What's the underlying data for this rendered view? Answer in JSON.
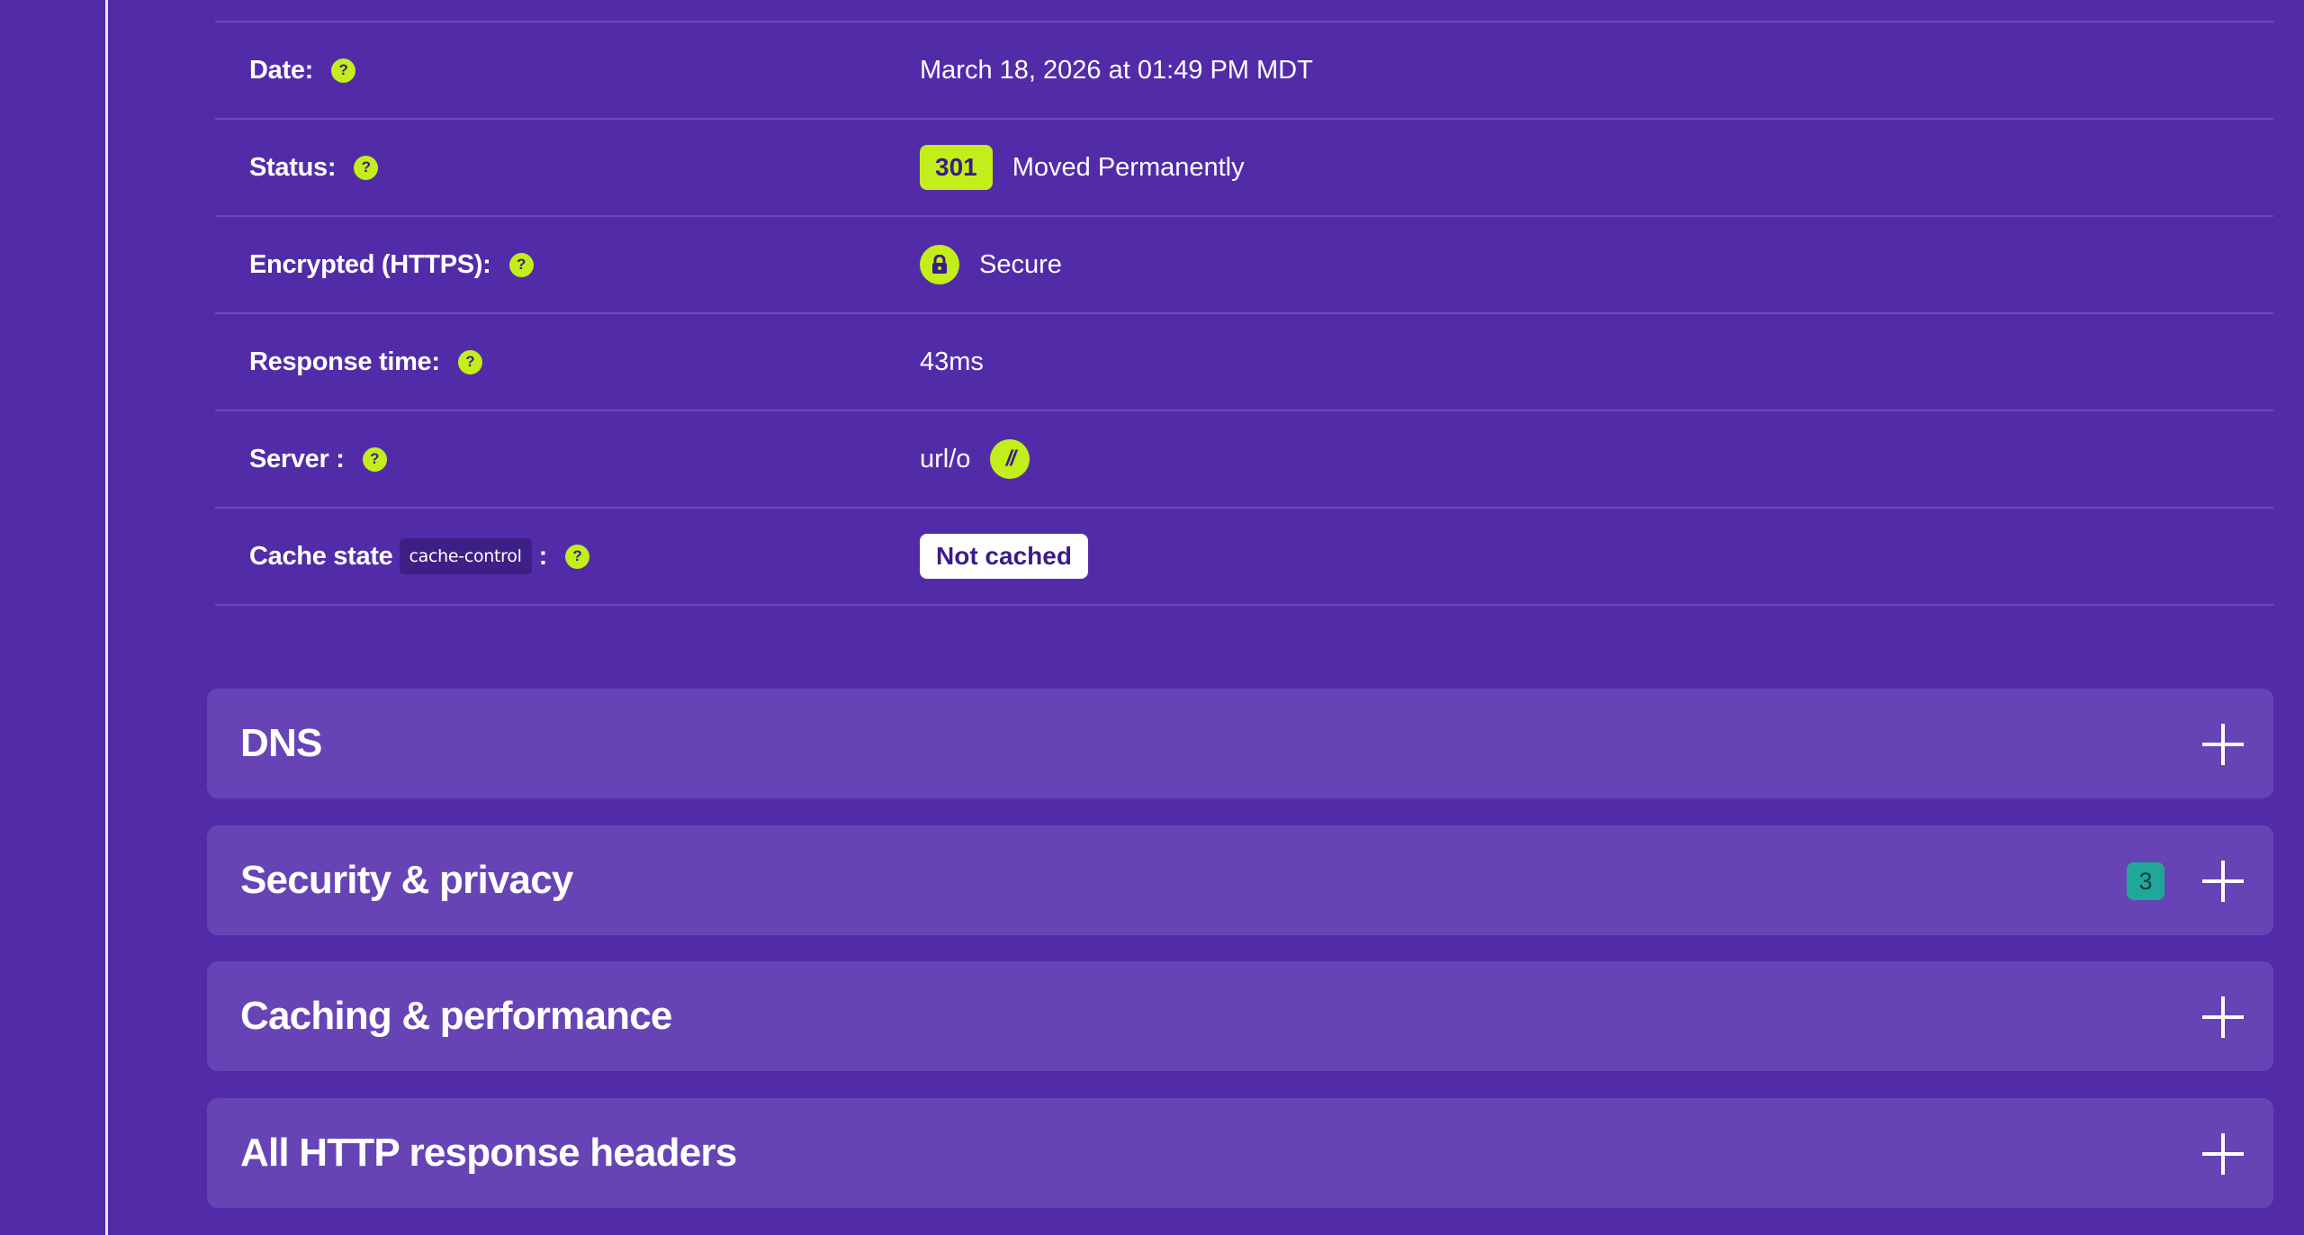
{
  "details": {
    "date": {
      "label": "Date:",
      "value": "March 18, 2026 at 01:49 PM MDT"
    },
    "status": {
      "label": "Status:",
      "code": "301",
      "text": "Moved Permanently"
    },
    "encrypted": {
      "label": "Encrypted (HTTPS):",
      "value": "Secure"
    },
    "response_time": {
      "label": "Response time:",
      "value": "43ms"
    },
    "server": {
      "label": "Server :",
      "value": "url/o",
      "logo_text": "//"
    },
    "cache_state": {
      "label": "Cache state",
      "chip": "cache-control",
      "colon": ":",
      "value": "Not cached"
    },
    "help_glyph": "?"
  },
  "sections": [
    {
      "title": "DNS"
    },
    {
      "title": "Security & privacy",
      "count": "3"
    },
    {
      "title": "Caching & performance"
    },
    {
      "title": "All HTTP response headers"
    }
  ],
  "colors": {
    "background": "#522CA8",
    "panel": "#6744B5",
    "accent_lime": "#C3EE1A",
    "count_badge": "#1fa89a"
  },
  "icons": {
    "help": "question-mark-circle-icon",
    "lock": "lock-icon",
    "expand": "plus-icon",
    "server_logo": "urlo-logo-icon"
  }
}
